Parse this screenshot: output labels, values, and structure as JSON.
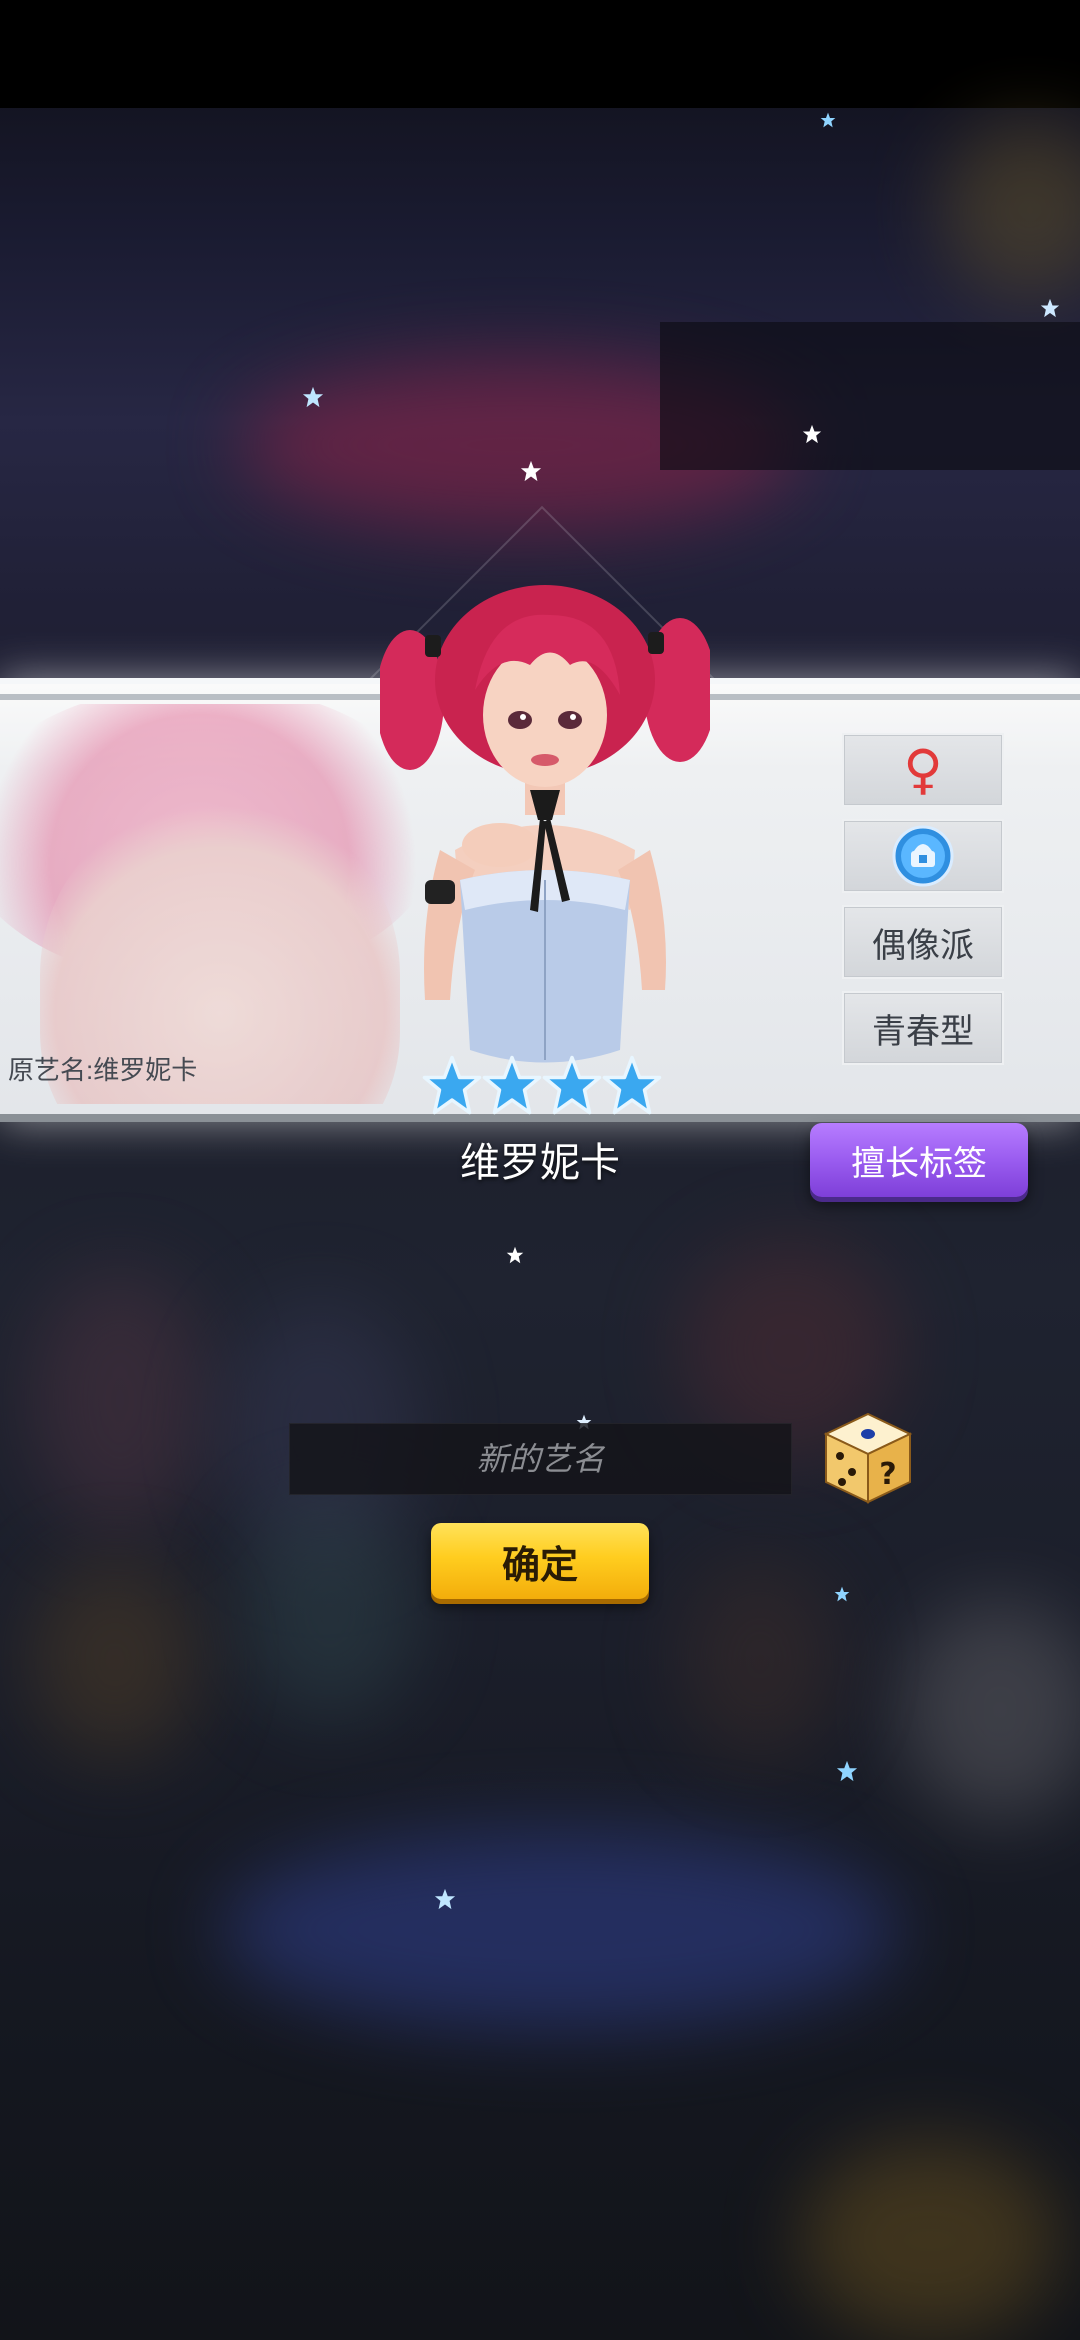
{
  "character": {
    "original_name_label": "原艺名:维罗妮卡",
    "name": "维罗妮卡",
    "star_rating": 4,
    "gender_symbol": "♀",
    "tags": [
      "偶像派",
      "青春型"
    ]
  },
  "buttons": {
    "skill_tags": "擅长标签",
    "confirm": "确定"
  },
  "name_input": {
    "placeholder": "新的艺名",
    "value": ""
  },
  "icons": {
    "gender": "female-icon",
    "type_badge": "character-type-icon",
    "dice": "random-name-dice-icon",
    "rating": "star-icon"
  },
  "colors": {
    "gender_icon": "#e23a3a",
    "skill_button": "#9a5cf0",
    "confirm_button": "#ffcd1f",
    "rating_star": "#3aa8f0"
  }
}
